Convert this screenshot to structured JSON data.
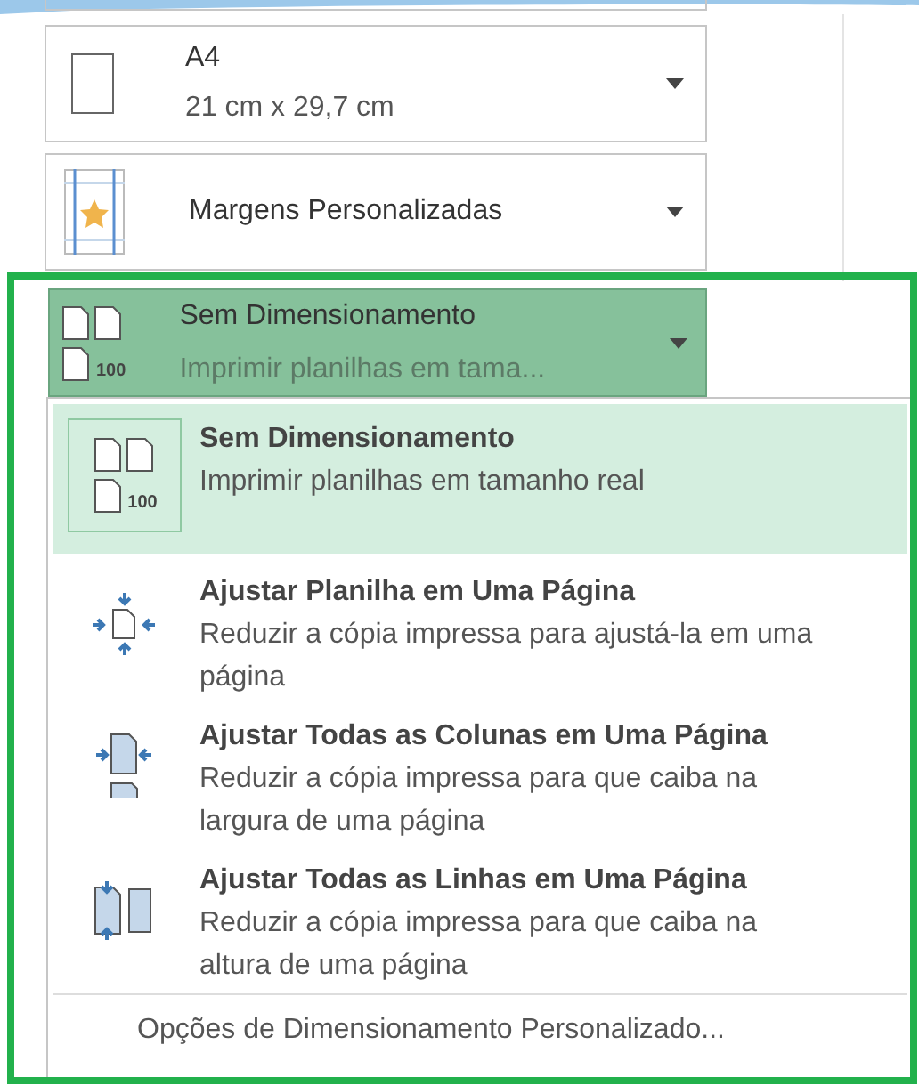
{
  "paper_size": {
    "name": "A4",
    "dimensions": "21 cm x 29,7 cm"
  },
  "margins": {
    "name": "Margens Personalizadas"
  },
  "scaling": {
    "icon_label": "100",
    "name": "Sem Dimensionamento",
    "description": "Imprimir planilhas em tama...",
    "expanded": true
  },
  "scaling_menu": {
    "items": [
      {
        "kind": "no-scaling",
        "icon_label": "100",
        "title": "Sem Dimensionamento",
        "description": "Imprimir planilhas em tamanho real",
        "selected": true
      },
      {
        "kind": "fit-sheet",
        "title": "Ajustar Planilha em Uma Página",
        "description": "Reduzir a cópia impressa para ajustá-la em uma página",
        "selected": false
      },
      {
        "kind": "fit-columns",
        "title": "Ajustar Todas as Colunas em Uma Página",
        "description": "Reduzir a cópia impressa para que caiba na largura de uma página",
        "selected": false
      },
      {
        "kind": "fit-rows",
        "title": "Ajustar Todas as Linhas em Uma Página",
        "description": "Reduzir a cópia impressa para que caiba na altura de uma página",
        "selected": false
      }
    ],
    "footer": "Opções de Dimensionamento Personalizado..."
  }
}
